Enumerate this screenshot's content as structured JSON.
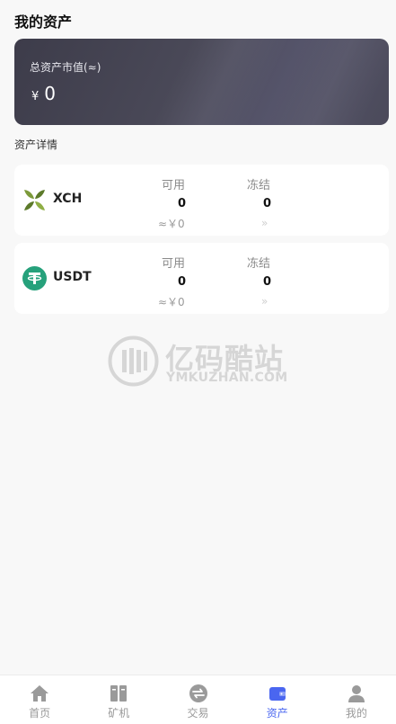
{
  "header": {
    "title": "我的资产"
  },
  "total_card": {
    "label": "总资产市值(≈)",
    "currency_symbol": "¥",
    "value": "0"
  },
  "section": {
    "title": "资产详情"
  },
  "assets": [
    {
      "symbol": "XCH",
      "icon": "xch-coin-icon",
      "available_label": "可用",
      "available_value": "0",
      "frozen_label": "冻结",
      "frozen_value": "0",
      "approx_value": "≈￥0",
      "arrow": "»"
    },
    {
      "symbol": "USDT",
      "icon": "usdt-coin-icon",
      "available_label": "可用",
      "available_value": "0",
      "frozen_label": "冻结",
      "frozen_value": "0",
      "approx_value": "≈￥0",
      "arrow": "»"
    }
  ],
  "watermark": {
    "chinese": "亿码酷站",
    "english": "YMKUZHAN.COM"
  },
  "tabbar": {
    "items": [
      {
        "label": "首页",
        "icon": "home-icon"
      },
      {
        "label": "矿机",
        "icon": "miner-icon"
      },
      {
        "label": "交易",
        "icon": "exchange-icon"
      },
      {
        "label": "资产",
        "icon": "wallet-icon",
        "active": true
      },
      {
        "label": "我的",
        "icon": "user-icon"
      }
    ]
  },
  "colors": {
    "accent": "#4a66f0",
    "card_dark": "#4a4958",
    "usdt_green": "#26a17b",
    "xch_green": "#7c9a3a"
  }
}
